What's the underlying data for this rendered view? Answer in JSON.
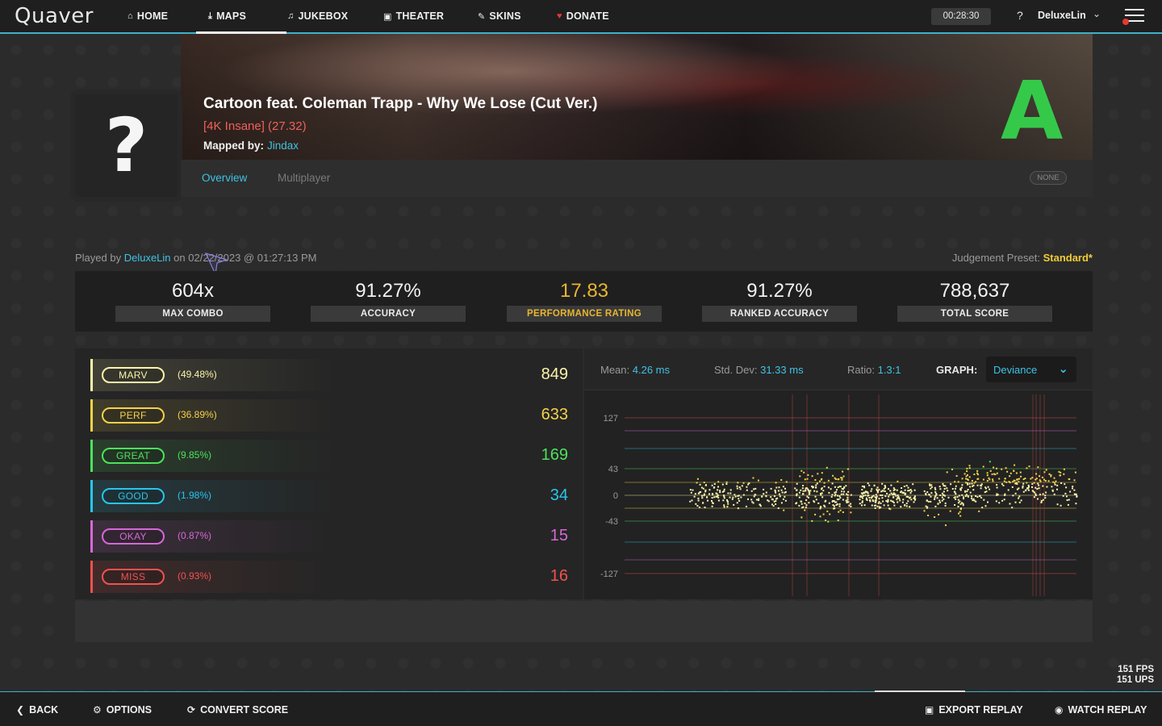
{
  "nav": {
    "logo": "Quaver",
    "items": [
      {
        "label": "HOME",
        "icon": "⌂"
      },
      {
        "label": "MAPS",
        "icon": "⤓"
      },
      {
        "label": "JUKEBOX",
        "icon": "♫"
      },
      {
        "label": "THEATER",
        "icon": "▣"
      },
      {
        "label": "SKINS",
        "icon": "✎"
      },
      {
        "label": "DONATE",
        "icon": "♥"
      }
    ],
    "timer": "00:28:30",
    "help": "?",
    "username": "DeluxeLin"
  },
  "map": {
    "title": "Cartoon feat. Coleman Trapp - Why We Lose (Cut Ver.)",
    "difficulty": "[4K Insane] (27.32)",
    "mapped_by_label": "Mapped by:",
    "mapper": "Jindax",
    "grade": "A",
    "cover_placeholder": "?"
  },
  "tabs": {
    "overview": "Overview",
    "multiplayer": "Multiplayer",
    "mods": "NONE"
  },
  "played": {
    "prefix": "Played by",
    "player": "DeluxeLin",
    "datetime": "on 02/22/2023 @ 01:27:13 PM",
    "judgement_label": "Judgement Preset:",
    "judgement_preset": "Standard*"
  },
  "stats": [
    {
      "value": "604x",
      "label": "MAX COMBO"
    },
    {
      "value": "91.27%",
      "label": "ACCURACY"
    },
    {
      "value": "17.83",
      "label": "PERFORMANCE RATING"
    },
    {
      "value": "91.27%",
      "label": "RANKED ACCURACY"
    },
    {
      "value": "788,637",
      "label": "TOTAL SCORE"
    }
  ],
  "judgements": [
    {
      "name": "MARV",
      "pct": "(49.48%)",
      "count": "849",
      "color": "#fcf4a9"
    },
    {
      "name": "PERF",
      "pct": "(36.89%)",
      "count": "633",
      "color": "#f4d24a"
    },
    {
      "name": "GREAT",
      "pct": "(9.85%)",
      "count": "169",
      "color": "#4ce35b"
    },
    {
      "name": "GOOD",
      "pct": "(1.98%)",
      "count": "34",
      "color": "#26c6f0"
    },
    {
      "name": "OKAY",
      "pct": "(0.87%)",
      "count": "15",
      "color": "#d768d7"
    },
    {
      "name": "MISS",
      "pct": "(0.93%)",
      "count": "16",
      "color": "#f2514f"
    }
  ],
  "graph": {
    "mean_label": "Mean:",
    "mean": "4.26 ms",
    "std_label": "Std. Dev:",
    "std": "31.33 ms",
    "ratio_label": "Ratio:",
    "ratio": "1.3:1",
    "graph_label": "GRAPH:",
    "graph_type": "Deviance",
    "y_ticks": [
      "127",
      "43",
      "0",
      "-43",
      "-127"
    ]
  },
  "fps": {
    "fps": "151 FPS",
    "ups": "151 UPS"
  },
  "bottom": {
    "back": "BACK",
    "options": "OPTIONS",
    "convert": "CONVERT SCORE",
    "export": "EXPORT REPLAY",
    "watch": "WATCH REPLAY"
  }
}
